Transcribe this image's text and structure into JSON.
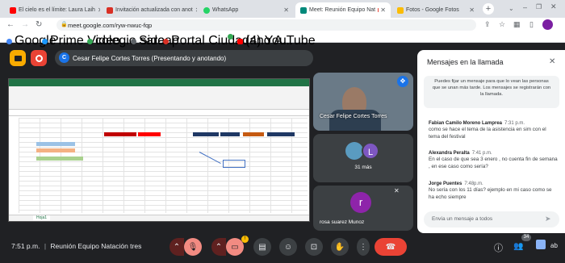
{
  "browser": {
    "tabs": [
      {
        "label": "El cielo es el límite: Laura Laih",
        "color": "#ff0000"
      },
      {
        "label": "Invitación actualizada con anot",
        "color": "#d93025"
      },
      {
        "label": "WhatsApp",
        "color": "#25d366"
      },
      {
        "label": "Meet: Reunión Equipo Nat",
        "color": "#00897b"
      },
      {
        "label": "Fotos - Google Fotos",
        "color": "#fbbc04"
      }
    ],
    "url": "meet.google.com/ryw-nwuc-fqp",
    "bookmarks": [
      {
        "label": "Google",
        "color": "#4285f4"
      },
      {
        "label": "Prime Video",
        "color": "#1a98ff"
      },
      {
        "label": "colegio sara",
        "color": "#34a853"
      },
      {
        "label": "Sideap",
        "color": "#5f6368"
      },
      {
        "label": "Portal Ciudadano A...",
        "color": "#d93025"
      },
      {
        "label": "",
        "color": "#34a853"
      },
      {
        "label": "(4) YouTube",
        "color": "#ff0000"
      }
    ]
  },
  "meet": {
    "presenter_initial": "C",
    "presenter_label": "Cesar Felipe Cortes Torres (Presentando y anotando)",
    "self_tile_name": "Cesar Felipe Cortes Torres",
    "group_tile_initial": "L",
    "group_tile_count": "31 más",
    "bottom_tile_initial": "r",
    "bottom_tile_name": "rosa suarez Munoz",
    "time": "7:51 p.m.",
    "meeting_name": "Reunión Equipo Natación tres",
    "people_count": "34",
    "activities_label": "ab"
  },
  "sheet": {
    "sheet_tab": "Hoja1",
    "cells": [
      "ESTUDIANT",
      "NOTA",
      "DE",
      "HOY",
      "VALOR",
      "ULTIMAS SEMI",
      "NOMBRE MICHEL GARCIA",
      "TARJETAS SEGUIDAS",
      "SOMBREROS DE CHOLO DE LA TORRE"
    ]
  },
  "chat": {
    "title": "Mensajes en la llamada",
    "notice": "Puedes fijar un mensaje para que lo vean las personas que se unan más tarde. Los mensajes se registrarán con la llamada.",
    "messages": [
      {
        "author": "Fabian Camilo Moreno Lamprea",
        "time": "7:31 p.m.",
        "text": "como se hace el tema de la asistencia en sim con el tema del festival"
      },
      {
        "author": "Alexandra Peralta",
        "time": "7:41 p.m.",
        "text": "En el caso de que sea 3 enero , no cuenta fin de semana , en ese caso como sería?"
      },
      {
        "author": "Jorge Puentes",
        "time": "7:48p.m.",
        "text": "No sería con los 11 días? ejemplo en mi caso como se ha echo siempre"
      }
    ],
    "input_placeholder": "Envía un mensaje a todos"
  },
  "colors": {
    "end_call": "#ea4335",
    "mic_off": "#f28b82",
    "accent": "#1a73e8"
  }
}
